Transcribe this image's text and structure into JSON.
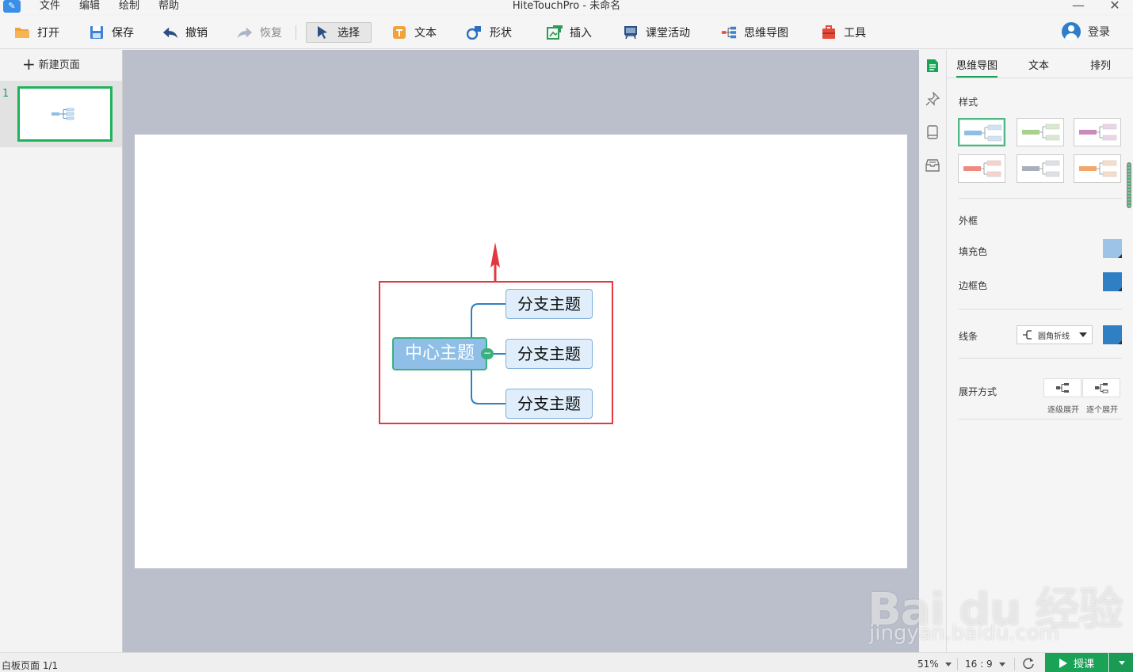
{
  "titlebar": {
    "title": "HiteTouchPro - 未命名",
    "menus": [
      "文件",
      "编辑",
      "绘制",
      "帮助"
    ],
    "minimize": "—",
    "close": "✕"
  },
  "toolbar": {
    "open": "打开",
    "save": "保存",
    "undo": "撤销",
    "redo": "恢复",
    "select": "选择",
    "text": "文本",
    "shape": "形状",
    "insert": "插入",
    "class_activity": "课堂活动",
    "mindmap": "思维导图",
    "tools": "工具",
    "login": "登录"
  },
  "left_panel": {
    "new_page": "新建页面",
    "pages": [
      {
        "number": "1"
      }
    ]
  },
  "mindmap": {
    "center": "中心主题",
    "branches": [
      "分支主题",
      "分支主题",
      "分支主题"
    ],
    "collapse_symbol": "−"
  },
  "right_panel": {
    "tabs": [
      "思维导图",
      "文本",
      "排列"
    ],
    "style_label": "样式",
    "styles": [
      {
        "bar": "#8fbfe6",
        "box": "#cfe3f5",
        "selected": true
      },
      {
        "bar": "#a9d18e",
        "box": "#d7ead0",
        "selected": false
      },
      {
        "bar": "#c98bbd",
        "box": "#ecd3e6",
        "selected": false
      },
      {
        "bar": "#f08a80",
        "box": "#f6d1cd",
        "selected": false
      },
      {
        "bar": "#a8b0bc",
        "box": "#dde0e5",
        "selected": false
      },
      {
        "bar": "#f3a66b",
        "box": "#f8dcc6",
        "selected": false
      }
    ],
    "frame_label": "外框",
    "fill_label": "填充色",
    "fill_color": "#9dc3e6",
    "border_label": "边框色",
    "border_color": "#2e7fc3",
    "line_label": "线条",
    "line_style": "圆角折线",
    "line_color": "#2e7fc3",
    "expand_label": "展开方式",
    "expand_options": [
      "逐级展开",
      "逐个展开"
    ]
  },
  "statusbar": {
    "page": "白板页面 1/1",
    "zoom": "51%",
    "ratio": "16 : 9",
    "teach": "授课"
  },
  "watermark": {
    "logo": "Bai du 经验",
    "url": "jingyan.baidu.com"
  }
}
